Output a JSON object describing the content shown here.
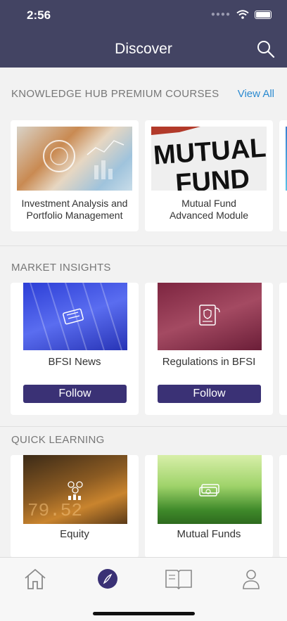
{
  "status": {
    "time": "2:56"
  },
  "header": {
    "title": "Discover"
  },
  "sections": {
    "premium": {
      "title": "KNOWLEDGE HUB PREMIUM COURSES",
      "view_all": "View All",
      "cards": [
        {
          "label_line1": "Investment Analysis and",
          "label_line2": "Portfolio Management"
        },
        {
          "label_line1": "Mutual Fund",
          "label_line2": "Advanced Module",
          "image_text_1": "MUTUAL",
          "image_text_2": "FUND"
        }
      ]
    },
    "market": {
      "title": "MARKET INSIGHTS",
      "cards": [
        {
          "label": "BFSI News",
          "button": "Follow"
        },
        {
          "label": "Regulations in BFSI",
          "button": "Follow"
        }
      ]
    },
    "quick": {
      "title": "QUICK LEARNING",
      "cards": [
        {
          "label": "Equity",
          "image_text": "79.52"
        },
        {
          "label": "Mutual Funds"
        }
      ]
    }
  },
  "tabs": [
    "home-icon",
    "compass-icon",
    "book-icon",
    "profile-icon"
  ],
  "colors": {
    "header": "#434463",
    "accent": "#3a3175",
    "link": "#2b8ad0"
  }
}
